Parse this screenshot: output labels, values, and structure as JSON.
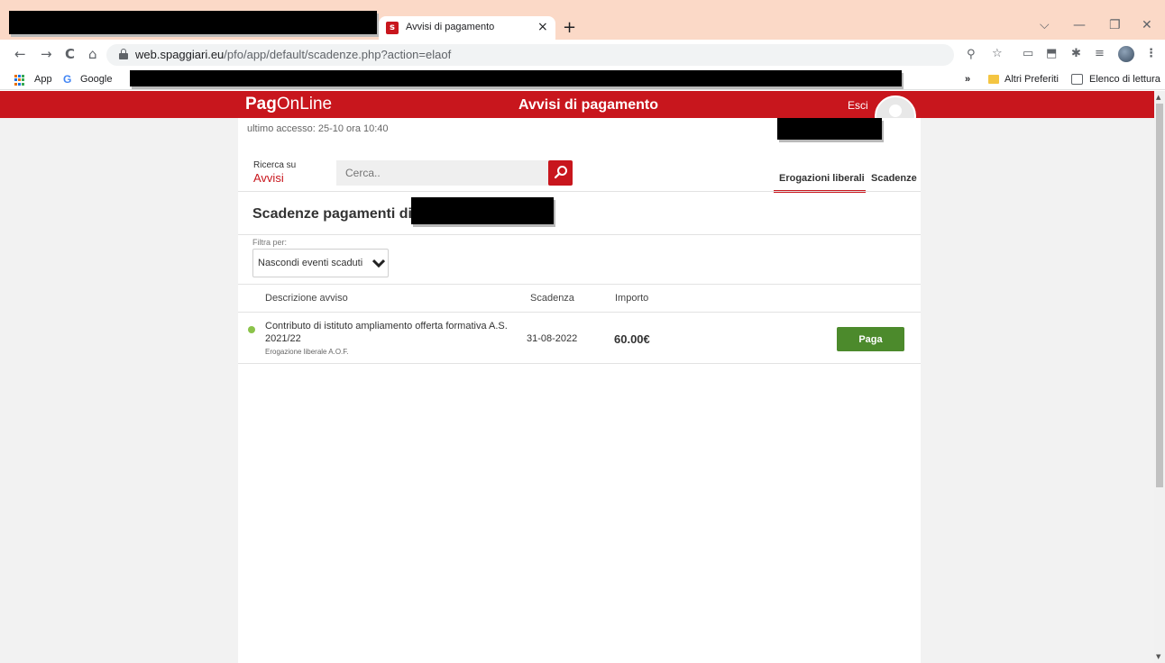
{
  "browser": {
    "tab": {
      "favicon": "s",
      "title": "Avvisi di pagamento",
      "close": "×"
    },
    "new_tab": "+",
    "window_controls": {
      "menu": "⌵",
      "minimize": "—",
      "restore": "❐",
      "close": "✕"
    },
    "nav": {
      "back": "←",
      "forward": "→",
      "reload": "C",
      "home": "⌂"
    },
    "url": {
      "host": "web.spaggiari.eu",
      "path": "/pfo/app/default/scadenze.php?action=elaof"
    },
    "toolbar_icons": {
      "zoom": "⚲",
      "star": "☆",
      "media": "▭",
      "extension": "⬒",
      "puzzle": "✱",
      "queue": "≡",
      "menu": "⋮"
    },
    "bookmarks": {
      "apps": "App",
      "google_logo": "G",
      "google": "Google",
      "overflow": "»",
      "folder": "Altri Preferiti",
      "reading_list": "Elenco di lettura"
    }
  },
  "page": {
    "brand": {
      "bold": "Pag",
      "light": "OnLine"
    },
    "heading": "Avvisi di pagamento",
    "logout": "Esci",
    "last_access": "ultimo accesso: 25-10 ora 10:40",
    "search": {
      "label_top": "Ricerca su",
      "label_bottom": "Avvisi",
      "placeholder": "Cerca.."
    },
    "tabs": {
      "active": "Erogazioni liberali",
      "other": "Scadenze"
    },
    "section_title": "Scadenze pagamenti di",
    "filter": {
      "label": "Filtra per:",
      "selected": "Nascondi eventi scaduti"
    },
    "columns": {
      "description": "Descrizione avviso",
      "due": "Scadenza",
      "amount": "Importo"
    },
    "rows": [
      {
        "description": "Contributo di istituto ampliamento offerta formativa A.S. 2021/22",
        "subtitle": "Erogazione liberale A.O.F.",
        "due": "31-08-2022",
        "amount": "60.00€",
        "action": "Paga",
        "status_color": "#8bc34a"
      }
    ]
  },
  "colors": {
    "brand_red": "#c8161d",
    "pay_green": "#4c8a2c",
    "tabstrip": "#fbd9c7"
  }
}
